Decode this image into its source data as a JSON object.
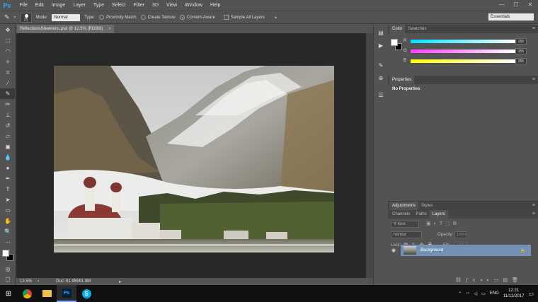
{
  "app": {
    "logo": "Ps"
  },
  "menu": [
    "File",
    "Edit",
    "Image",
    "Layer",
    "Type",
    "Select",
    "Filter",
    "3D",
    "View",
    "Window",
    "Help"
  ],
  "window_controls": {
    "minimize": "—",
    "maximize": "☐",
    "close": "✕"
  },
  "options": {
    "brush_size": "25",
    "mode_label": "Mode:",
    "mode_value": "Normal",
    "type_label": "Type:",
    "type_options": [
      "Proximity Match",
      "Create Texture",
      "Content-Aware"
    ],
    "type_selected": "Content-Aware",
    "sample_all_layers": "Sample All Layers",
    "workspace": "Essentials"
  },
  "document": {
    "tab_title": "ReflectionsSteeklens.psd @ 12.5% (RGB/8)",
    "zoom": "12.5%",
    "doc_size": "Doc: 61.9M/61.9M"
  },
  "color_panel": {
    "tabs": [
      "Color",
      "Swatches"
    ],
    "sliders": [
      {
        "label": "R",
        "value": "255",
        "color": "#00e0ff"
      },
      {
        "label": "G",
        "value": "255",
        "color": "#ff3cff"
      },
      {
        "label": "B",
        "value": "255",
        "color": "#ffff00"
      }
    ]
  },
  "properties_panel": {
    "tab": "Properties",
    "message": "No Properties"
  },
  "adjustments_panel": {
    "tabs": [
      "Adjustments",
      "Styles"
    ]
  },
  "layers_panel": {
    "tabs": [
      "Channels",
      "Paths",
      "Layers"
    ],
    "active_tab": "Layers",
    "kind": "Kind",
    "blend_mode": "Normal",
    "opacity_label": "Opacity:",
    "opacity_value": "100%",
    "lock_label": "Lock:",
    "fill_label": "Fill:",
    "fill_value": "100%",
    "layers": [
      {
        "name": "Background",
        "locked": true
      }
    ]
  },
  "taskbar": {
    "language": "ENG",
    "time": "12:21",
    "date": "11/12/2017"
  }
}
